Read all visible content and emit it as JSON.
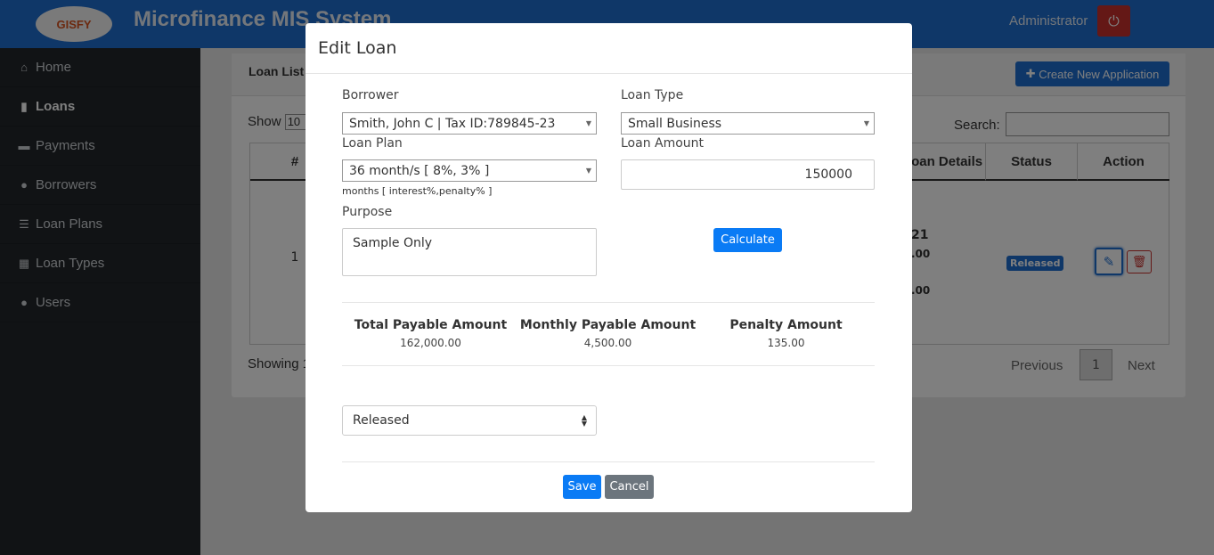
{
  "header": {
    "logo_text": "GISFY",
    "app_title": "Microfinance MIS System",
    "user_name": "Administrator",
    "logout_icon": "power-icon",
    "brand_color": "#1f6fd1"
  },
  "sidebar": {
    "items": [
      {
        "label": "Home",
        "icon": "home-icon"
      },
      {
        "label": "Loans",
        "icon": "file-icon"
      },
      {
        "label": "Payments",
        "icon": "money-icon"
      },
      {
        "label": "Borrowers",
        "icon": "users-icon"
      },
      {
        "label": "Loan Plans",
        "icon": "list-icon"
      },
      {
        "label": "Loan Types",
        "icon": "table-icon"
      },
      {
        "label": "Users",
        "icon": "users-icon"
      }
    ]
  },
  "main": {
    "card_title": "Loan List",
    "create_label": "Create New Application",
    "show_label": "Show",
    "show_value": "10",
    "search_label": "Search:",
    "columns": [
      "#",
      "Loan Details",
      "Status",
      "Action"
    ],
    "row": {
      "num": "1",
      "details_fragments": [
        "21",
        ".00",
        ".00"
      ],
      "status": "Released"
    },
    "showing_text": "Showing 1",
    "pagination": {
      "prev": "Previous",
      "page": "1",
      "next": "Next"
    }
  },
  "modal": {
    "title": "Edit Loan",
    "borrower_label": "Borrower",
    "borrower_value": "Smith, John C | Tax ID:789845-23",
    "loan_type_label": "Loan Type",
    "loan_type_value": "Small Business",
    "loan_plan_label": "Loan Plan",
    "loan_plan_value": "36 month/s [ 8%, 3% ]",
    "loan_plan_hint": "months [ interest%,penalty% ]",
    "loan_amount_label": "Loan Amount",
    "loan_amount_value": "150000",
    "purpose_label": "Purpose",
    "purpose_value": "Sample Only",
    "calculate_label": "Calculate",
    "summary": [
      {
        "title": "Total Payable Amount",
        "value": "162,000.00"
      },
      {
        "title": "Monthly Payable Amount",
        "value": "4,500.00"
      },
      {
        "title": "Penalty Amount",
        "value": "135.00"
      }
    ],
    "status_value": "Released",
    "save_label": "Save",
    "cancel_label": "Cancel"
  }
}
